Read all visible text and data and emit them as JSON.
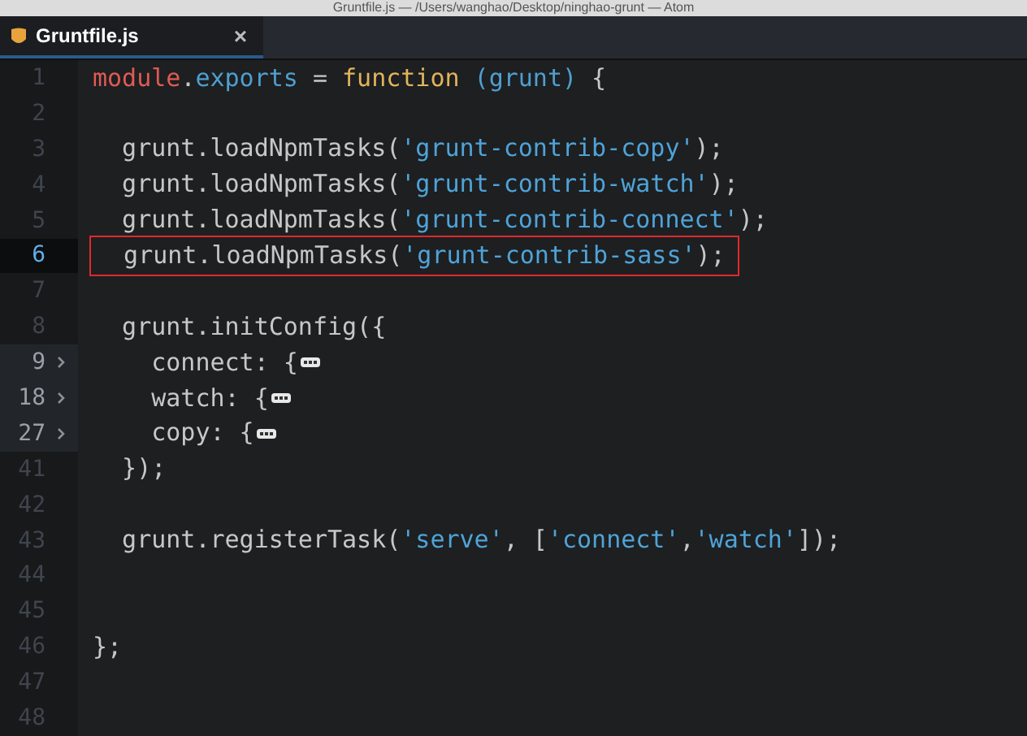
{
  "window": {
    "title": "Gruntfile.js — /Users/wanghao/Desktop/ninghao-grunt — Atom"
  },
  "tabs": [
    {
      "label": "Gruntfile.js",
      "close": "×",
      "selected": true
    }
  ],
  "editor": {
    "lines": [
      {
        "number": "1",
        "cursor": false,
        "folded": false,
        "highlighted": false,
        "tokens": [
          {
            "kind": "variable",
            "text": "module"
          },
          {
            "kind": "plain",
            "text": "."
          },
          {
            "kind": "property",
            "text": "exports"
          },
          {
            "kind": "plain",
            "text": " = "
          },
          {
            "kind": "keyword",
            "text": "function"
          },
          {
            "kind": "param",
            "text": " (grunt)"
          },
          {
            "kind": "plain",
            "text": " {"
          }
        ]
      },
      {
        "number": "2",
        "cursor": false,
        "folded": false,
        "highlighted": false
      },
      {
        "number": "3",
        "cursor": false,
        "folded": false,
        "highlighted": false,
        "tokens": [
          {
            "kind": "plain",
            "text": "  grunt.loadNpmTasks("
          },
          {
            "kind": "string",
            "text": "'grunt-contrib-copy'"
          },
          {
            "kind": "plain",
            "text": ");"
          }
        ]
      },
      {
        "number": "4",
        "cursor": false,
        "folded": false,
        "highlighted": false,
        "tokens": [
          {
            "kind": "plain",
            "text": "  grunt.loadNpmTasks("
          },
          {
            "kind": "string",
            "text": "'grunt-contrib-watch'"
          },
          {
            "kind": "plain",
            "text": ");"
          }
        ]
      },
      {
        "number": "5",
        "cursor": false,
        "folded": false,
        "highlighted": false,
        "tokens": [
          {
            "kind": "plain",
            "text": "  grunt.loadNpmTasks("
          },
          {
            "kind": "string",
            "text": "'grunt-contrib-connect'"
          },
          {
            "kind": "plain",
            "text": ");"
          }
        ]
      },
      {
        "number": "6",
        "cursor": true,
        "folded": false,
        "highlighted": true,
        "tokens": [
          {
            "kind": "plain",
            "text": "  grunt.loadNpmTasks("
          },
          {
            "kind": "string",
            "text": "'grunt-contrib-sass'"
          },
          {
            "kind": "plain",
            "text": ");"
          }
        ]
      },
      {
        "number": "7",
        "cursor": false,
        "folded": false,
        "highlighted": false
      },
      {
        "number": "8",
        "cursor": false,
        "folded": false,
        "highlighted": false,
        "tokens": [
          {
            "kind": "plain",
            "text": "  grunt.initConfig({"
          }
        ]
      },
      {
        "number": "9",
        "cursor": false,
        "folded": true,
        "highlighted": false,
        "tokens": [
          {
            "kind": "plain",
            "text": "    connect: {"
          }
        ]
      },
      {
        "number": "18",
        "cursor": false,
        "folded": true,
        "highlighted": false,
        "tokens": [
          {
            "kind": "plain",
            "text": "    watch: {"
          }
        ]
      },
      {
        "number": "27",
        "cursor": false,
        "folded": true,
        "highlighted": false,
        "tokens": [
          {
            "kind": "plain",
            "text": "    copy: {"
          }
        ]
      },
      {
        "number": "41",
        "cursor": false,
        "folded": false,
        "highlighted": false,
        "tokens": [
          {
            "kind": "plain",
            "text": "  });"
          }
        ]
      },
      {
        "number": "42",
        "cursor": false,
        "folded": false,
        "highlighted": false
      },
      {
        "number": "43",
        "cursor": false,
        "folded": false,
        "highlighted": false,
        "tokens": [
          {
            "kind": "plain",
            "text": "  grunt.registerTask("
          },
          {
            "kind": "string",
            "text": "'serve'"
          },
          {
            "kind": "plain",
            "text": ", ["
          },
          {
            "kind": "string",
            "text": "'connect'"
          },
          {
            "kind": "plain",
            "text": ","
          },
          {
            "kind": "string",
            "text": "'watch'"
          },
          {
            "kind": "plain",
            "text": "]);"
          }
        ]
      },
      {
        "number": "44",
        "cursor": false,
        "folded": false,
        "highlighted": false
      },
      {
        "number": "45",
        "cursor": false,
        "folded": false,
        "highlighted": false
      },
      {
        "number": "46",
        "cursor": false,
        "folded": false,
        "highlighted": false,
        "tokens": [
          {
            "kind": "plain",
            "text": "};"
          }
        ]
      },
      {
        "number": "47",
        "cursor": false,
        "folded": false,
        "highlighted": false
      },
      {
        "number": "48",
        "cursor": false,
        "folded": false,
        "highlighted": false
      }
    ]
  }
}
